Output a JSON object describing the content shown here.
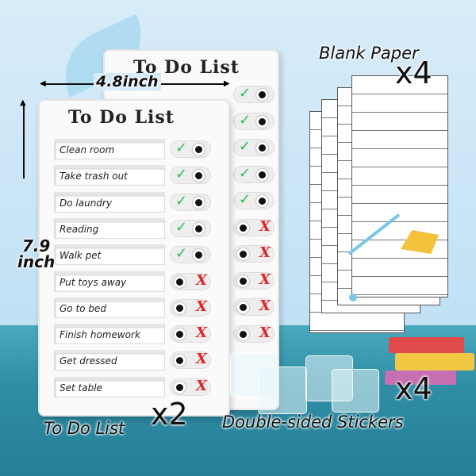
{
  "board_title": "To Do List",
  "dimensions": {
    "width": "4.8inch",
    "height_num": "7.9",
    "height_unit": "inch"
  },
  "front_tasks": [
    {
      "label": "Clean room",
      "state": "done"
    },
    {
      "label": "Take trash out",
      "state": "done"
    },
    {
      "label": "Do laundry",
      "state": "done"
    },
    {
      "label": "Reading",
      "state": "done"
    },
    {
      "label": "Walk pet",
      "state": "done"
    },
    {
      "label": "Put toys away",
      "state": "todo"
    },
    {
      "label": "Go to bed",
      "state": "todo"
    },
    {
      "label": "Finish homework",
      "state": "todo"
    },
    {
      "label": "Get dressed",
      "state": "todo"
    },
    {
      "label": "Set table",
      "state": "todo"
    }
  ],
  "back_states": [
    "done",
    "done",
    "done",
    "done",
    "done",
    "todo",
    "todo",
    "todo",
    "todo",
    "todo"
  ],
  "symbols": {
    "done": "✓",
    "todo": "X"
  },
  "colors": {
    "check": "#2ebd52",
    "cross": "#e0262a",
    "table": "#2f8ea5",
    "background": "#c4e2f5"
  },
  "captions": {
    "blank_paper": "Blank Paper",
    "blank_paper_qty": "x4",
    "todo_list": "To Do List",
    "todo_list_qty": "x2",
    "stickers": "Double-sided Stickers",
    "stickers_qty": "x4"
  }
}
